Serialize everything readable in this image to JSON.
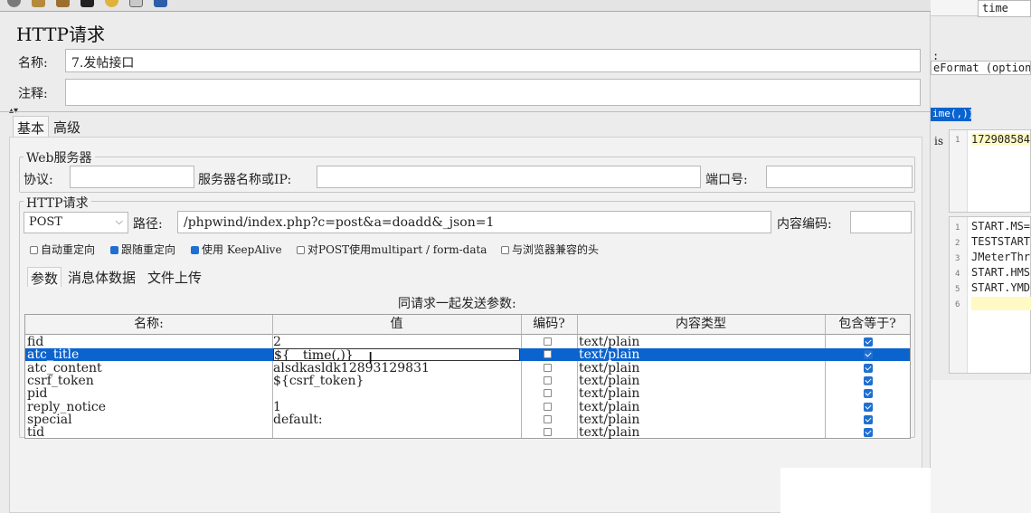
{
  "panel_title": "HTTP请求",
  "name": {
    "label": "名称:",
    "value": "7.发帖接口"
  },
  "comment": {
    "label": "注释:",
    "value": ""
  },
  "tabs": [
    {
      "label": "基本"
    },
    {
      "label": "高级"
    }
  ],
  "web_server": {
    "title": "Web服务器",
    "protocol_label": "协议:",
    "server_label": "服务器名称或IP:",
    "port_label": "端口号:"
  },
  "http_request": {
    "title": "HTTP请求",
    "method": "POST",
    "path_label": "路径:",
    "path": "/phpwind/index.php?c=post&a=doadd&_json=1",
    "encoding_label": "内容编码:"
  },
  "options": [
    {
      "label": "自动重定向",
      "checked": false
    },
    {
      "label": "跟随重定向",
      "checked": true
    },
    {
      "label": "使用 KeepAlive",
      "checked": true
    },
    {
      "label": "对POST使用multipart / form-data",
      "checked": false
    },
    {
      "label": "与浏览器兼容的头",
      "checked": false
    }
  ],
  "subtabs": [
    {
      "label": "参数"
    },
    {
      "label": "消息体数据"
    },
    {
      "label": "文件上传"
    }
  ],
  "params_caption": "同请求一起发送参数:",
  "columns": [
    "名称:",
    "值",
    "编码?",
    "内容类型",
    "包含等于?"
  ],
  "params": [
    {
      "name": "fid",
      "value": "2",
      "encode": false,
      "type": "text/plain",
      "include_equals": true
    },
    {
      "name": "atc_title",
      "value": "${__time(,)}",
      "encode": false,
      "type": "text/plain",
      "include_equals": true
    },
    {
      "name": "atc_content",
      "value": "alsdkasldk12893129831",
      "encode": false,
      "type": "text/plain",
      "include_equals": true
    },
    {
      "name": "csrf_token",
      "value": "${csrf_token}",
      "encode": false,
      "type": "text/plain",
      "include_equals": true
    },
    {
      "name": "pid",
      "value": "",
      "encode": false,
      "type": "text/plain",
      "include_equals": true
    },
    {
      "name": "reply_notice",
      "value": "1",
      "encode": false,
      "type": "text/plain",
      "include_equals": true
    },
    {
      "name": "special",
      "value": "default:",
      "encode": false,
      "type": "text/plain",
      "include_equals": true
    },
    {
      "name": "tid",
      "value": "",
      "encode": false,
      "type": "text/plain",
      "include_equals": true
    }
  ],
  "selected_row": 1,
  "side_panel": {
    "top_field": "time",
    "colon": ":",
    "format_label": "eFormat (optional)",
    "function_preview": "ime(,)}",
    "result_label": "is",
    "result_lines": [
      {
        "n": "1",
        "text": "172908584"
      }
    ],
    "var_lines": [
      {
        "n": "1",
        "text": "START.MS="
      },
      {
        "n": "2",
        "text": "TESTSTART"
      },
      {
        "n": "3",
        "text": "JMeterThr"
      },
      {
        "n": "4",
        "text": "START.HMS"
      },
      {
        "n": "5",
        "text": "START.YMD"
      },
      {
        "n": "6",
        "text": ""
      }
    ]
  },
  "colors": {
    "selection": "#0b63ce",
    "checkbox": "#1f6fd1",
    "highlight": "#fff9c4"
  }
}
